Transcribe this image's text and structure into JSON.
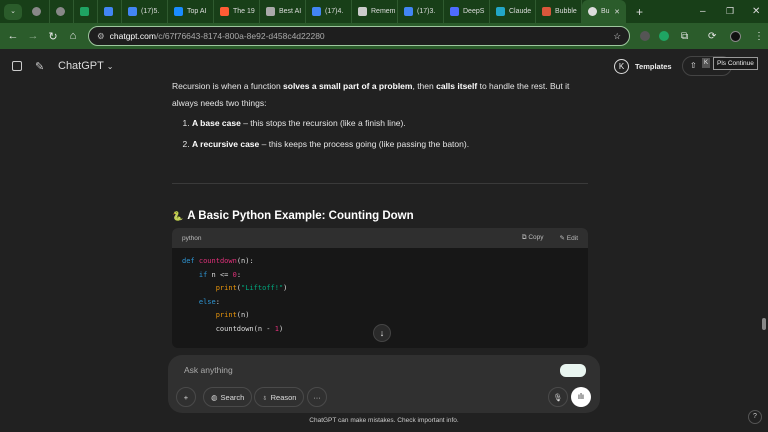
{
  "browser": {
    "tabs": [
      {
        "label": "",
        "icon": "globe-icon",
        "color": "#888"
      },
      {
        "label": "",
        "icon": "globe-icon",
        "color": "#888"
      },
      {
        "label": "",
        "icon": "sheets-icon",
        "color": "#1fa463"
      },
      {
        "label": "",
        "icon": "docs-icon",
        "color": "#4285f4"
      },
      {
        "label": "(17)5.",
        "icon": "docs-icon",
        "color": "#4285f4"
      },
      {
        "label": "Top AI",
        "icon": "site-icon",
        "color": "#1a8cff"
      },
      {
        "label": "The 19",
        "icon": "hubspot-icon",
        "color": "#ff5c35"
      },
      {
        "label": "Best AI",
        "icon": "site-icon",
        "color": "#aaaaaa"
      },
      {
        "label": "(17)4.",
        "icon": "docs-icon",
        "color": "#4285f4"
      },
      {
        "label": "Remem",
        "icon": "site-icon",
        "color": "#cccccc"
      },
      {
        "label": "(17)3.",
        "icon": "docs-icon",
        "color": "#4285f4"
      },
      {
        "label": "DeepS",
        "icon": "deepseek-icon",
        "color": "#4d6bfe"
      },
      {
        "label": "Claude",
        "icon": "claude-icon",
        "color": "#22a7c7"
      },
      {
        "label": "Bubble",
        "icon": "bubble-icon",
        "color": "#d9573b"
      },
      {
        "label": "Bu",
        "icon": "chatgpt-icon",
        "color": "#dddddd",
        "active": true
      }
    ],
    "new_tab": "+",
    "url_host": "chatgpt.com",
    "url_path": "/c/67f76643-8174-800a-8e92-d458c4d22280"
  },
  "app": {
    "title": "ChatGPT",
    "templates": "Templates",
    "tooltip": "Pls Continue",
    "k": "K"
  },
  "message": {
    "p1_a": "Recursion is when a function ",
    "p1_b": "solves a small part of a problem",
    "p1_c": ", then ",
    "p1_d": "calls itself",
    "p1_e": " to handle the rest. But it always needs two things:",
    "items": [
      {
        "bold": "A base case",
        "text": " – this stops the recursion (like a finish line)."
      },
      {
        "bold": "A recursive case",
        "text": " – this keeps the process going (like passing the baton)."
      }
    ],
    "heading": "A Basic Python Example: Counting Down",
    "heading_emoji": "🐍"
  },
  "code": {
    "lang": "python",
    "copy": "Copy",
    "edit": "Edit",
    "t": {
      "def": "def",
      "fn": "countdown",
      "args": "(n):",
      "if": "if",
      "cond": " n <= ",
      "zero": "0",
      "colon": ":",
      "print": "print",
      "lp": "(",
      "str": "\"Liftoff!\"",
      "rp": ")",
      "else": "else",
      "pn": "(n)",
      "call": "countdown(n - ",
      "one": "1",
      "close": ")"
    }
  },
  "composer": {
    "placeholder": "Ask anything",
    "search": "Search",
    "reason": "Reason",
    "more": "···"
  },
  "footer": "ChatGPT can make mistakes. Check important info."
}
